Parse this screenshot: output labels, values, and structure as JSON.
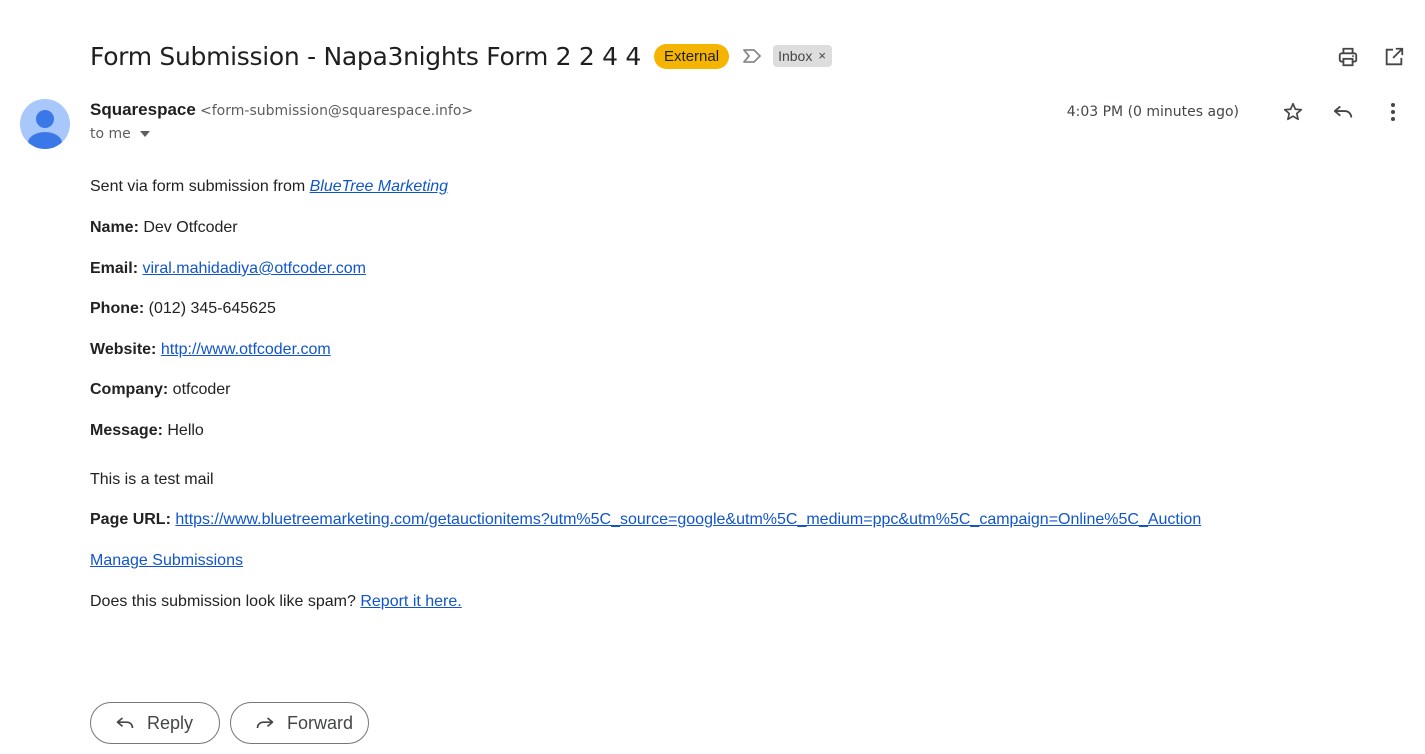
{
  "subject": {
    "title": "Form Submission - Napa3nights Form 2 2 4 4",
    "external_badge": "External",
    "label": "Inbox",
    "label_remove": "×"
  },
  "sender": {
    "name": "Squarespace",
    "email": "<form-submission@squarespace.info>",
    "to": "to me",
    "timestamp": "4:03 PM (0 minutes ago)"
  },
  "body": {
    "intro_prefix": "Sent via form submission from ",
    "intro_link": "BlueTree Marketing",
    "fields": [
      {
        "label": "Name:",
        "value": " Dev Otfcoder"
      },
      {
        "label": "Email:",
        "link": "viral.mahidadiya@otfcoder.com"
      },
      {
        "label": "Phone:",
        "value": " (012) 345-645625"
      },
      {
        "label": "Website:",
        "link": "http://www.otfcoder.com"
      },
      {
        "label": "Company:",
        "value": " otfcoder"
      },
      {
        "label": "Message:",
        "value": " Hello"
      }
    ],
    "message_extra": "This is a test mail",
    "page_url_label": "Page URL:",
    "page_url": "https://www.bluetreemarketing.com/getauctionitems?utm%5C_source=google&utm%5C_medium=ppc&utm%5C_campaign=Online%5C_Auction",
    "manage_link": "Manage Submissions",
    "spam_prefix": "Does this submission look like spam? ",
    "spam_link": "Report it here."
  },
  "actions": {
    "reply": "Reply",
    "forward": "Forward"
  },
  "icons": {
    "print": "print-icon",
    "open_new_window": "open-in-new-window-icon",
    "star": "star-icon",
    "reply": "reply-icon",
    "more": "more-vert-icon",
    "important": "important-marker-icon",
    "avatar": "person-avatar-icon"
  },
  "colors": {
    "external_badge": "#f5b400",
    "label_chip": "#dddddd",
    "link": "#1155cc",
    "avatar_bg": "#a8c7fa",
    "avatar_fg": "#3b78e7"
  }
}
